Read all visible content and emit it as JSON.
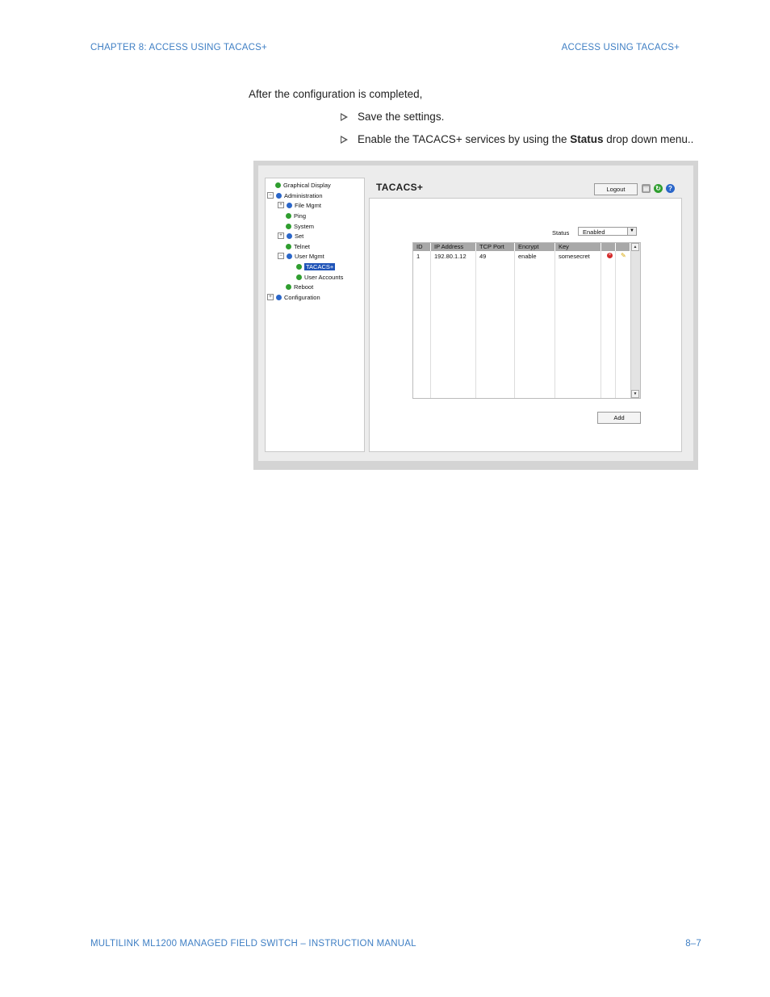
{
  "header": {
    "left": "CHAPTER 8: ACCESS USING TACACS+",
    "right": "ACCESS USING TACACS+"
  },
  "intro": "After the configuration is completed,",
  "bullets": {
    "b1": "Save the settings.",
    "b2_pre": "Enable the TACACS+ services by using the ",
    "b2_bold": "Status",
    "b2_post": " drop down menu.."
  },
  "screenshot": {
    "tree": [
      "Graphical Display",
      "Administration",
      "File Mgmt",
      "Ping",
      "System",
      "Set",
      "Telnet",
      "User Mgmt",
      "TACACS+",
      "User Accounts",
      "Reboot",
      "Configuration"
    ],
    "title": "TACACS+",
    "logout_label": "Logout",
    "icons": {
      "print": "print-icon",
      "refresh": "refresh-icon",
      "help": "help-icon"
    },
    "status_label": "Status",
    "status_value": "Enabled",
    "table": {
      "headers": [
        "ID",
        "IP Address",
        "TCP Port",
        "Encrypt",
        "Key"
      ],
      "rows": [
        [
          "1",
          "192.80.1.12",
          "49",
          "enable",
          "somesecret"
        ]
      ]
    },
    "add_label": "Add"
  },
  "footer": {
    "left": "MULTILINK ML1200 MANAGED FIELD SWITCH – INSTRUCTION MANUAL",
    "right": "8–7"
  }
}
